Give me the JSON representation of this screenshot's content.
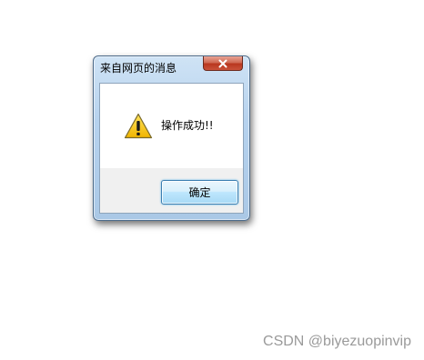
{
  "dialog": {
    "title": "来自网页的消息",
    "message": "操作成功!!",
    "ok_label": "确定",
    "icons": {
      "message_icon": "warning-icon",
      "close_icon": "close-icon"
    },
    "colors": {
      "close_button": "#c9523a",
      "ok_border": "#3c7fb1",
      "warning_fill": "#f5c400"
    }
  },
  "watermark": {
    "text": "CSDN @biyezuopinvip"
  }
}
